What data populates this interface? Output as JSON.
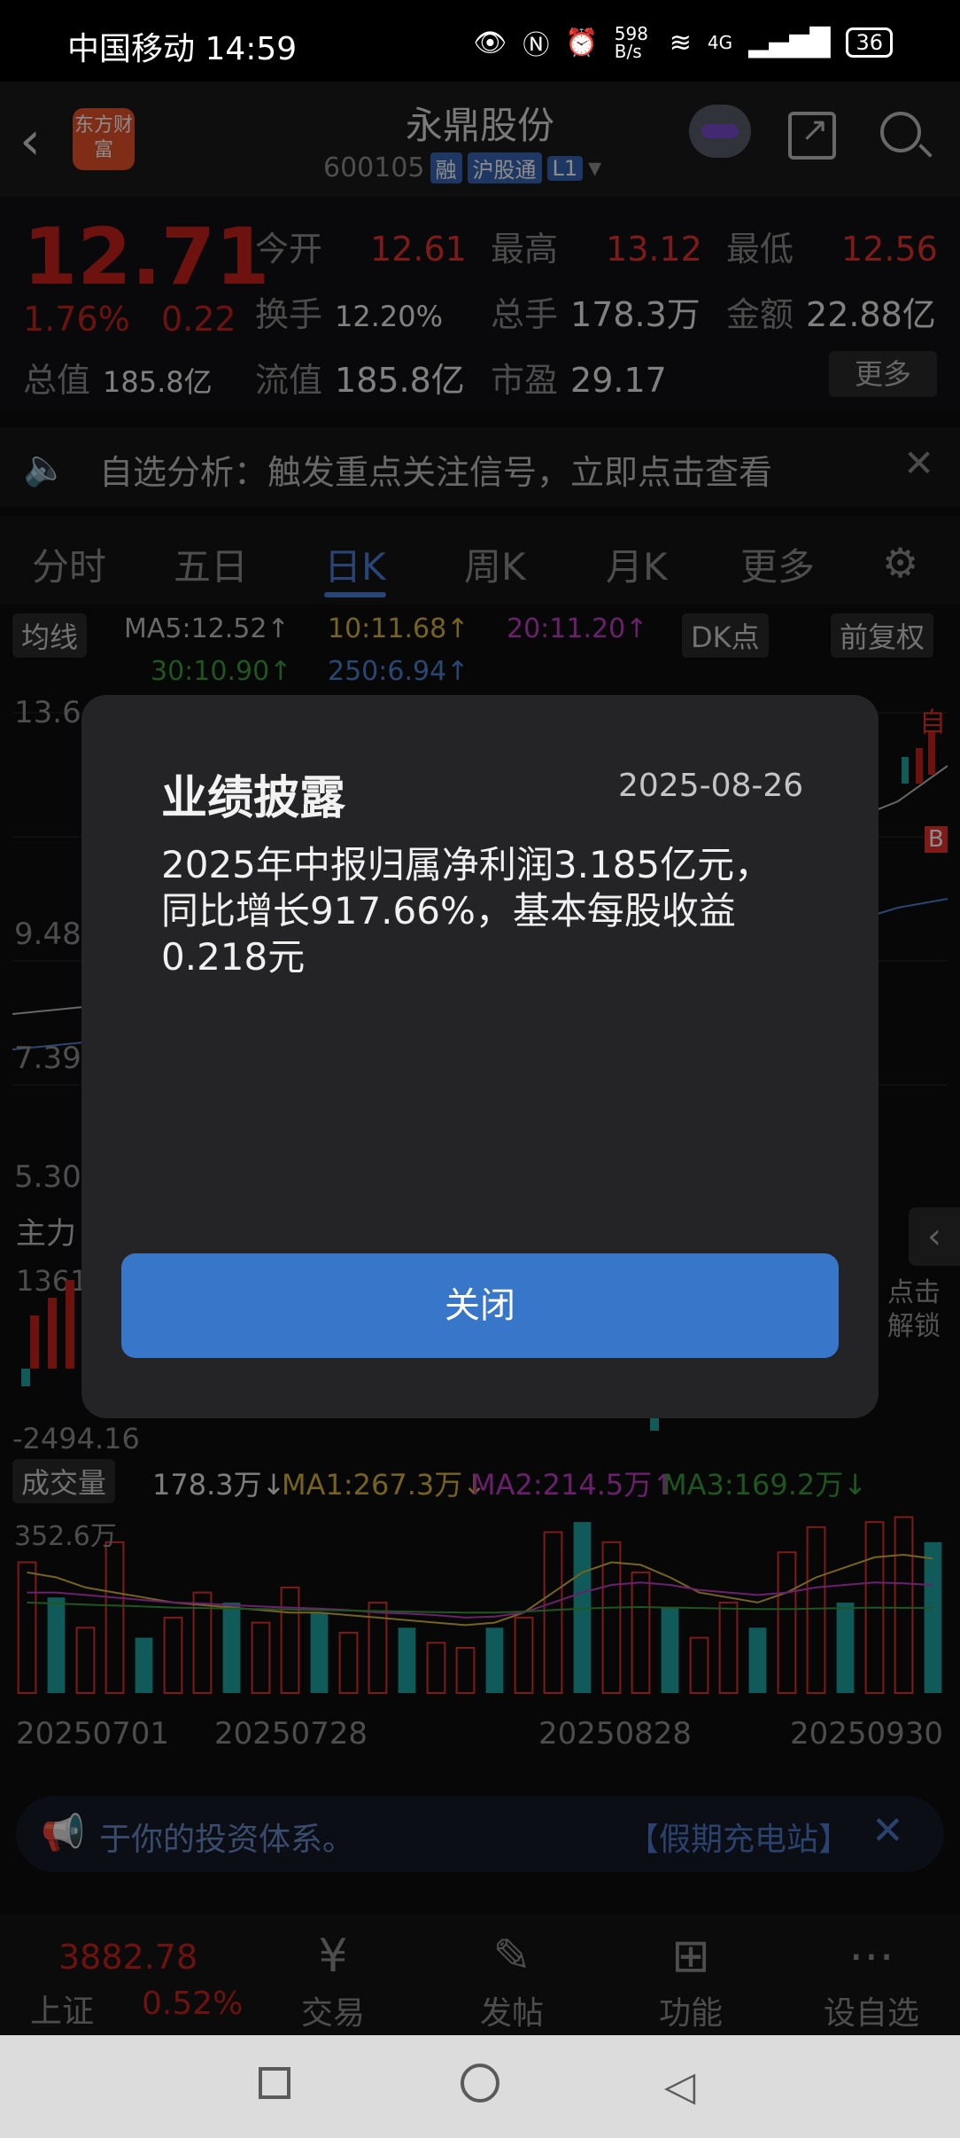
{
  "status_bar": {
    "carrier_time": "中国移动 14:59",
    "net_speed": "598 B/s",
    "signal": "4G",
    "battery": "36"
  },
  "header": {
    "logo_text": "东方财富",
    "stock_name": "永鼎股份",
    "code": "600105",
    "tags": [
      "融",
      "沪股通",
      "L1"
    ]
  },
  "quote": {
    "price": "12.71",
    "change_pct": "1.76%",
    "change": "0.22",
    "fields": [
      {
        "k": "今开",
        "v": "12.61",
        "color": "red"
      },
      {
        "k": "最高",
        "v": "13.12",
        "color": "red"
      },
      {
        "k": "最低",
        "v": "12.56",
        "color": "red"
      },
      {
        "k": "换手",
        "v": "12.20%",
        "color": "plain"
      },
      {
        "k": "总手",
        "v": "178.3万",
        "color": "plain"
      },
      {
        "k": "金额",
        "v": "22.88亿",
        "color": "plain"
      },
      {
        "k": "总值",
        "v": "185.8亿",
        "color": "plain"
      },
      {
        "k": "流值",
        "v": "185.8亿",
        "color": "plain"
      },
      {
        "k": "市盈",
        "v": "29.17",
        "color": "plain"
      }
    ],
    "more_label": "更多"
  },
  "notice": {
    "text": "自选分析：触发重点关注信号，立即点击查看"
  },
  "tabs": [
    "分时",
    "五日",
    "日K",
    "周K",
    "月K",
    "更多"
  ],
  "ma_row": {
    "selector": "均线",
    "ma5": "MA5:12.52↑",
    "ma10": "10:11.68↑",
    "ma20": "20:11.20↑",
    "ma30": "30:10.90↑",
    "ma250": "250:6.94↑",
    "dk": "DK点",
    "adjust": "前复权"
  },
  "chart": {
    "price_ticks": [
      "13.6",
      "9.48",
      "7.39",
      "5.30"
    ],
    "fund_label": "主力",
    "fund_ticks": [
      "1361",
      "-2494.16"
    ],
    "side_tab": "自",
    "badge": "B"
  },
  "volume": {
    "label": "成交量",
    "total": "178.3万↓",
    "ma1": "MA1:267.3万↓",
    "ma2": "MA2:214.5万↑",
    "ma3": "MA3:169.2万↓",
    "max_tick": "352.6万",
    "dates": [
      "20250701",
      "20250728",
      "20250828",
      "20250930"
    ]
  },
  "chart_data": {
    "type": "bar",
    "title": "成交量",
    "categories": [
      "20250701",
      "20250728",
      "20250828",
      "20250930"
    ],
    "ylim": [
      0,
      352.6
    ],
    "ylabel": "万",
    "series": [
      {
        "name": "成交量",
        "values": [
          260,
          190,
          130,
          300,
          110,
          150,
          200,
          180,
          140,
          210,
          160,
          120,
          180,
          130,
          100,
          90,
          130,
          150,
          320,
          340,
          300,
          240,
          170,
          110,
          180,
          130,
          280,
          330,
          180,
          340,
          350,
          300
        ]
      },
      {
        "name": "MA1",
        "values": [
          240,
          230,
          210,
          200,
          190,
          180,
          175,
          170,
          165,
          160,
          160,
          155,
          150,
          145,
          140,
          135,
          140,
          160,
          200,
          240,
          260,
          255,
          230,
          200,
          190,
          180,
          200,
          230,
          250,
          270,
          275,
          267.3
        ]
      },
      {
        "name": "MA2",
        "values": [
          200,
          200,
          195,
          190,
          185,
          180,
          178,
          175,
          172,
          170,
          168,
          165,
          160,
          158,
          155,
          150,
          152,
          160,
          180,
          200,
          215,
          220,
          215,
          205,
          200,
          195,
          200,
          210,
          215,
          220,
          218,
          214.5
        ]
      },
      {
        "name": "MA3",
        "values": [
          180,
          178,
          176,
          174,
          172,
          170,
          169,
          168,
          167,
          166,
          165,
          164,
          163,
          162,
          161,
          160,
          160,
          162,
          165,
          168,
          170,
          171,
          170,
          169,
          168,
          167,
          167,
          168,
          169,
          170,
          169.5,
          169.2
        ]
      }
    ]
  },
  "unlock": {
    "text": "点击解锁"
  },
  "banner": {
    "text": "于你的投资体系。",
    "link": "【假期充电站】"
  },
  "bottom_nav": {
    "index_name": "上证",
    "index_value": "3882.78",
    "index_change": "0.52%",
    "items": [
      "交易",
      "发帖",
      "功能",
      "设自选"
    ]
  },
  "modal": {
    "title": "业绩披露",
    "date": "2025-08-26",
    "body": "2025年中报归属净利润3.185亿元，同比增长917.66%，基本每股收益0.218元",
    "close_label": "关闭"
  },
  "colors": {
    "up": "#e5322d",
    "down": "#20a5a5",
    "accent": "#3876c9"
  }
}
